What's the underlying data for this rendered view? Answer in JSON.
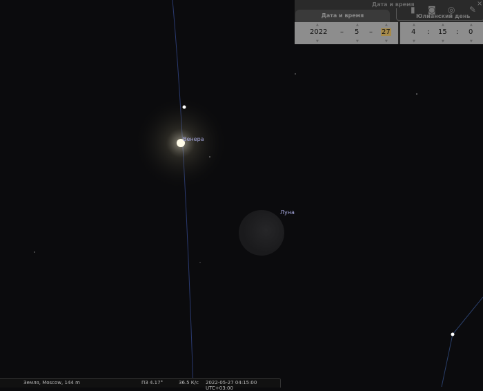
{
  "sky": {
    "venus_label": "Венера",
    "moon_label": "Луна"
  },
  "panel": {
    "title": "Дата и время",
    "tab_label": "Дата и время",
    "julian_label": "Юлианский день",
    "date": {
      "year": "2022",
      "month": "5",
      "day": "27",
      "sep": "–"
    },
    "time": {
      "hour": "4",
      "minute": "15",
      "second": "0",
      "sep": ":"
    },
    "close": "×"
  },
  "status": {
    "location": "Земля, Moscow, 144 m",
    "fov": "ПЗ 4.17°",
    "fps": "36.5 К/с",
    "datetime": "2022-05-27 04:15:00 UTC+03:00"
  }
}
